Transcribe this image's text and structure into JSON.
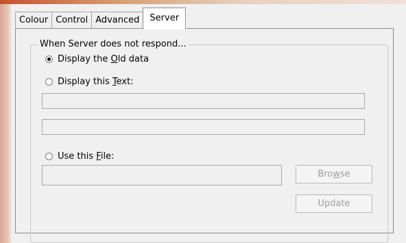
{
  "tabs": [
    {
      "label": "Colour"
    },
    {
      "label": "Control"
    },
    {
      "label": "Advanced"
    },
    {
      "label": "Server",
      "active": true
    }
  ],
  "group": {
    "label": "When Server does not respond...",
    "options": [
      {
        "before": "Display the ",
        "mnemonic": "O",
        "after": "ld data",
        "checked": true
      },
      {
        "before": "Display this ",
        "mnemonic": "T",
        "after": "ext:",
        "checked": false
      },
      {
        "before": "Use this ",
        "mnemonic": "F",
        "after": "ile:",
        "checked": false
      }
    ],
    "text_line_1": "",
    "text_line_2": "",
    "file_path": ""
  },
  "buttons": {
    "browse": {
      "before": "Bro",
      "mnemonic": "w",
      "after": "se",
      "enabled": false
    },
    "update": {
      "label": "Update",
      "enabled": false
    }
  }
}
